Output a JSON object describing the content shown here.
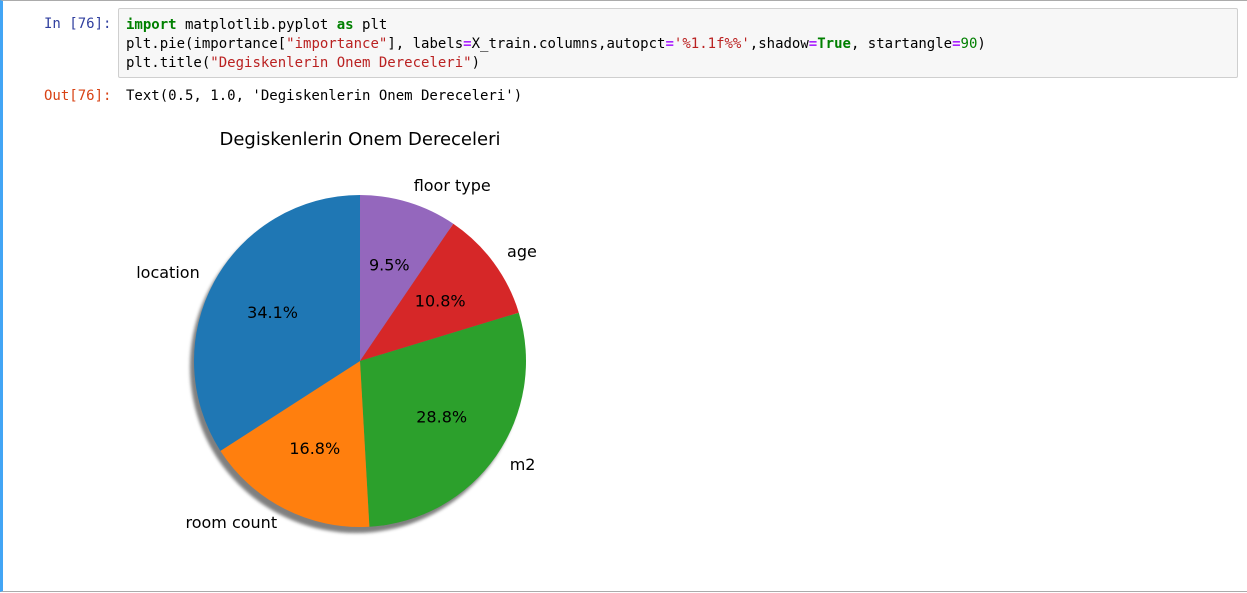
{
  "cell": {
    "in_prompt": "In [76]:",
    "out_prompt": "Out[76]:",
    "code": {
      "line1": {
        "k1": "import",
        "t1": " matplotlib.pyplot ",
        "k2": "as",
        "t2": " plt"
      },
      "line2": {
        "a": "plt.pie(importance[",
        "s1": "\"importance\"",
        "b": "], labels",
        "eq1": "=",
        "c": "X_train.columns,autopct",
        "eq2": "=",
        "s2": "'%1.1f%%'",
        "d": ",shadow",
        "eq3": "=",
        "k": "True",
        "e": ", startangle",
        "eq4": "=",
        "n": "90",
        "f": ")"
      },
      "line3": {
        "a": "plt.title(",
        "s": "\"Degiskenlerin Onem Dereceleri\"",
        "b": ")"
      }
    },
    "output_text": "Text(0.5, 1.0, 'Degiskenlerin Onem Dereceleri')"
  },
  "chart_data": {
    "type": "pie",
    "title": "Degiskenlerin Onem Dereceleri",
    "startangle": 90,
    "shadow": true,
    "slices": [
      {
        "label": "floor type",
        "value": 9.5,
        "pct": "9.5%",
        "color": "#9467bd"
      },
      {
        "label": "age",
        "value": 10.8,
        "pct": "10.8%",
        "color": "#d62728"
      },
      {
        "label": "m2",
        "value": 28.8,
        "pct": "28.8%",
        "color": "#2ca02c"
      },
      {
        "label": "room count",
        "value": 16.8,
        "pct": "16.8%",
        "color": "#ff7f0e"
      },
      {
        "label": "location",
        "value": 34.1,
        "pct": "34.1%",
        "color": "#1f77b4"
      }
    ]
  }
}
